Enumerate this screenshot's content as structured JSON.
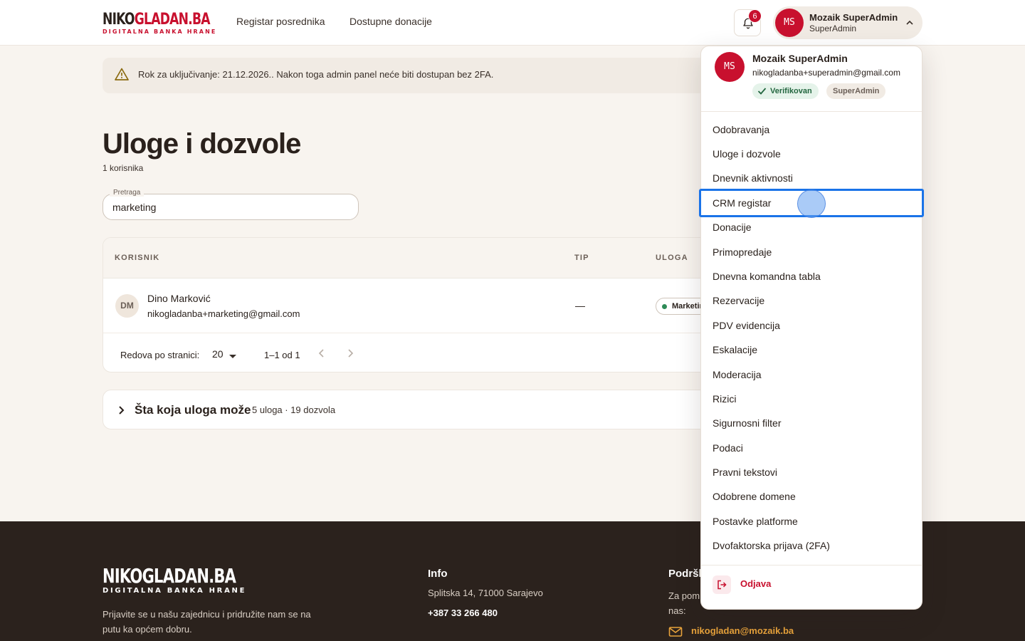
{
  "header": {
    "logo_main_dark": "NIKO",
    "logo_main_red": "GLADAN.BA",
    "logo_sub": "DIGITALNA BANKA HRANE",
    "nav": [
      "Registar posrednika",
      "Dostupne donacije"
    ],
    "notifications_count": "6",
    "user": {
      "initials": "MS",
      "name": "Mozaik SuperAdmin",
      "role": "SuperAdmin"
    }
  },
  "alert": {
    "text": "Rok za uključivanje: 21.12.2026.. Nakon toga admin panel neće biti dostupan bez 2FA."
  },
  "page": {
    "title": "Uloge i dozvole",
    "subtitle": "1 korisnika"
  },
  "search": {
    "label": "Pretraga",
    "value": "marketing"
  },
  "table": {
    "columns": [
      "KORISNIK",
      "TIP",
      "ULOGA"
    ],
    "rows": [
      {
        "initials": "DM",
        "name": "Dino Marković",
        "email": "nikogladanba+marketing@gmail.com",
        "tip": "—",
        "role": "Marketing"
      }
    ],
    "rows_per_page_label": "Redova po stranici:",
    "rows_per_page_value": "20",
    "range": "1–1 od 1"
  },
  "accordion": {
    "title": "Šta koja uloga može",
    "summary": "5 uloga · 19 dozvola"
  },
  "footer": {
    "logo_main": "NIKOGLADAN.BA",
    "logo_sub": "DIGITALNA BANKA HRANE",
    "tagline": "Prijavite se u našu zajednicu i pridružite nam se na putu ka općem dobru.",
    "info_heading": "Info",
    "address": "Splitska 14, 71000 Sarajevo",
    "phone": "+387 33 266 480",
    "support_heading": "Podršk",
    "support_text": "Za pom nas:",
    "email": "nikogladan@mozaik.ba"
  },
  "dropdown": {
    "initials": "MS",
    "name": "Mozaik SuperAdmin",
    "email": "nikogladanba+superadmin@gmail.com",
    "verified": "Verifikovan",
    "role": "SuperAdmin",
    "items": [
      "Odobravanja",
      "Uloge i dozvole",
      "Dnevnik aktivnosti",
      "CRM registar",
      "Donacije",
      "Primopredaje",
      "Dnevna komandna tabla",
      "Rezervacije",
      "PDV evidencija",
      "Eskalacije",
      "Moderacija",
      "Rizici",
      "Sigurnosni filter",
      "Podaci",
      "Pravni tekstovi",
      "Odobrene domene",
      "Postavke platforme",
      "Dvofaktorska prijava (2FA)"
    ],
    "focused_item": "CRM registar",
    "logout": "Odjava"
  },
  "colors": {
    "brand_red": "#c8102e",
    "footer_bg": "#2b221d",
    "page_bg": "#f8f4ef",
    "focus_ring": "#1a73e8",
    "email_accent": "#e8a33b"
  }
}
